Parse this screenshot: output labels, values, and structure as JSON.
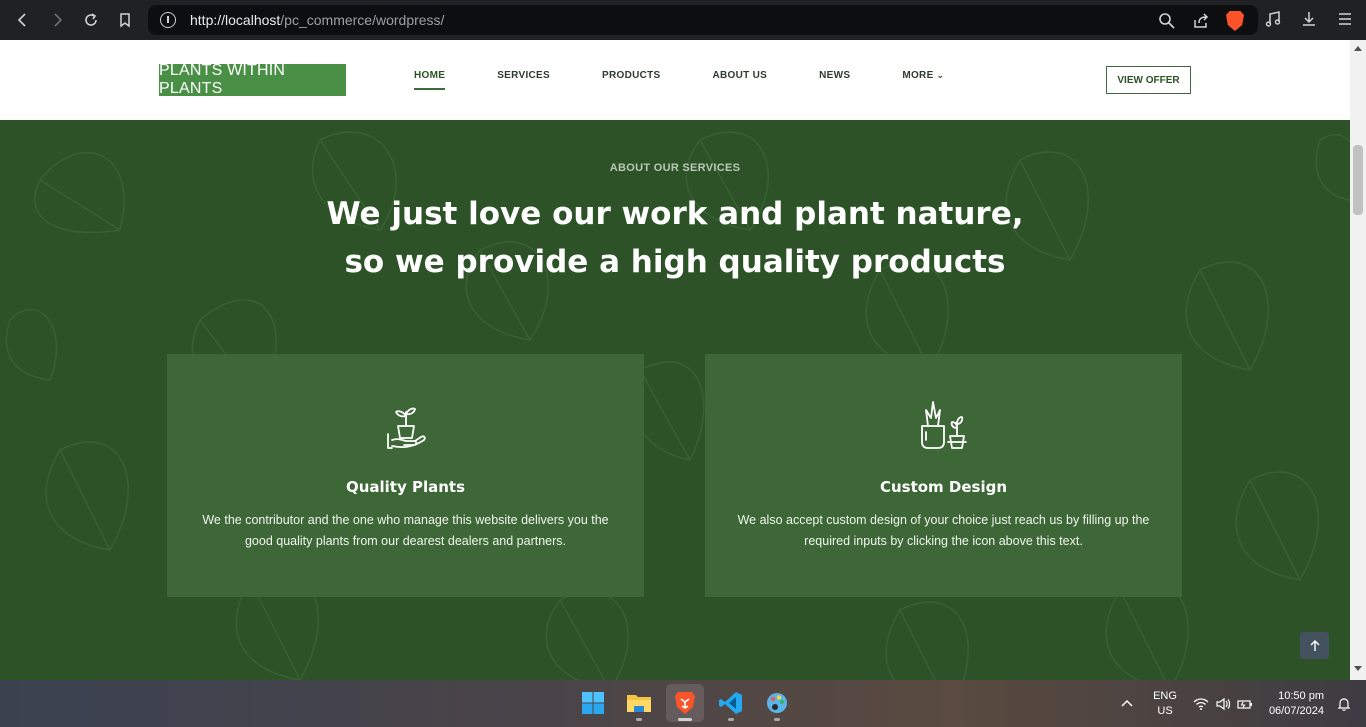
{
  "browser": {
    "url_host": "http://localhost",
    "url_path": "/pc_commerce/wordpress/"
  },
  "site": {
    "logo": "PLANTS WITHIN PLANTS",
    "menu": [
      {
        "label": "HOME"
      },
      {
        "label": "SERVICES"
      },
      {
        "label": "PRODUCTS"
      },
      {
        "label": "ABOUT US"
      },
      {
        "label": "NEWS"
      },
      {
        "label": "MORE"
      }
    ],
    "cta": "VIEW OFFER"
  },
  "hero": {
    "eyebrow": "ABOUT OUR SERVICES",
    "headline_line1": "We just love our work and plant nature,",
    "headline_line2": "so we provide a high quality products"
  },
  "cards": [
    {
      "icon": "plant-in-hand-icon",
      "title": "Quality Plants",
      "text_line1": "We the contributor and the one who manage this website delivers you the",
      "text_line2": "good quality plants from our dearest dealers and partners."
    },
    {
      "icon": "potted-plants-icon",
      "title": "Custom Design",
      "text_line1": "We also accept custom design of your choice just reach us by filling up the",
      "text_line2": "required inputs by clicking the icon above this text."
    }
  ],
  "taskbar": {
    "language": "ENG",
    "region": "US",
    "time": "10:50 pm",
    "date": "06/07/2024"
  },
  "colors": {
    "hero_bg": "#2d5228",
    "card_bg": "#3d6737",
    "logo_bg": "#4a8f46"
  }
}
